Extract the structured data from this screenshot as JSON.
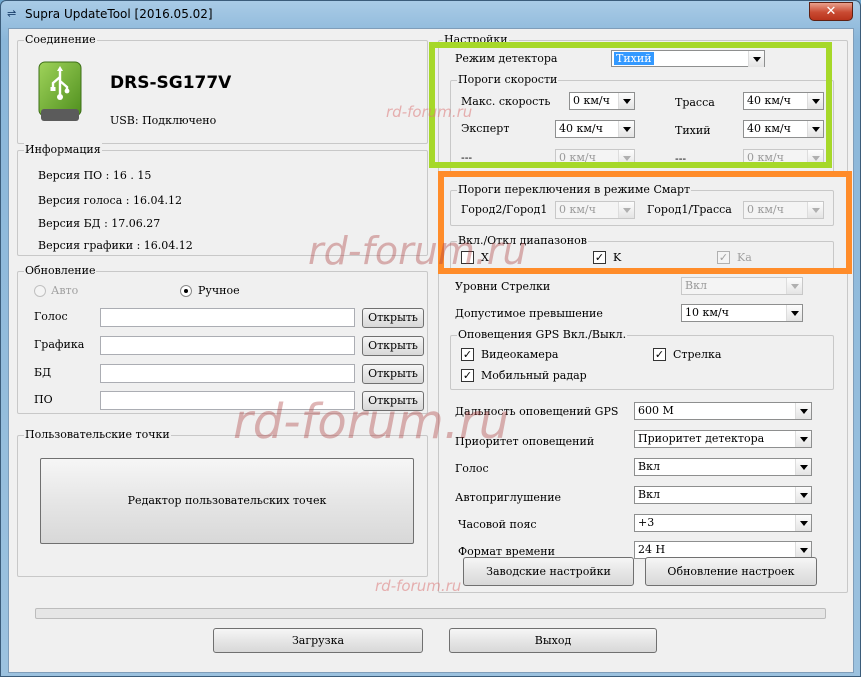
{
  "window": {
    "title": "Supra UpdateTool [2016.05.02]",
    "close_label": "✕"
  },
  "connection": {
    "legend": "Соединение",
    "device": "DRS-SG177V",
    "usb_status": "USB: Подключено"
  },
  "info": {
    "legend": "Информация",
    "fw": "Версия ПО : 16 . 15",
    "voice": "Версия голоса : 16.04.12",
    "db": "Версия БД : 17.06.27",
    "graphics": "Версия графики : 16.04.12"
  },
  "update": {
    "legend": "Обновление",
    "auto": "Авто",
    "manual": "Ручное",
    "rows": [
      {
        "label": "Голос",
        "value": "",
        "button": "Открыть"
      },
      {
        "label": "Графика",
        "value": "",
        "button": "Открыть"
      },
      {
        "label": "БД",
        "value": "",
        "button": "Открыть"
      },
      {
        "label": "ПО",
        "value": "",
        "button": "Открыть"
      }
    ]
  },
  "user_points": {
    "legend": "Пользовательские точки",
    "editor_button": "Редактор пользовательских точек"
  },
  "settings": {
    "legend": "Настройки",
    "detector_mode_label": "Режим детектора",
    "detector_mode_value": "Тихий",
    "speed": {
      "legend": "Пороги скорости",
      "max_label": "Макс. скорость",
      "max_value": "0 км/ч",
      "highway_label": "Трасса",
      "highway_value": "40 км/ч",
      "expert_label": "Эксперт",
      "expert_value": "40 км/ч",
      "quiet_label": "Тихий",
      "quiet_value": "40 км/ч",
      "dash1_label": "---",
      "dash1_value": "0 км/ч",
      "dash2_label": "---",
      "dash2_value": "0 км/ч"
    },
    "smart": {
      "legend": "Пороги переключения в режиме Смарт",
      "city2_label": "Город2/Город1",
      "city2_value": "0 км/ч",
      "city1_label": "Город1/Трасса",
      "city1_value": "0 км/ч"
    },
    "bands": {
      "legend": "Вкл./Откл диапазонов",
      "x": "X",
      "k": "K",
      "ka": "Ka"
    },
    "arrow_levels_label": "Уровни Стрелки",
    "arrow_levels_value": "Вкл",
    "overspeed_label": "Допустимое превышение",
    "overspeed_value": "10 км/ч",
    "gps": {
      "legend": "Оповещения GPS Вкл./Выкл.",
      "camera": "Видеокамера",
      "arrow": "Стрелка",
      "radar": "Мобильный радар"
    },
    "gps_range_label": "Дальность оповещений GPS",
    "gps_range_value": "600 M",
    "priority_label": "Приоритет оповещений",
    "priority_value": "Приоритет детектора",
    "voice_label": "Голос",
    "voice_value": "Вкл",
    "automute_label": "Автоприглушение",
    "automute_value": "Вкл",
    "tz_label": "Часовой пояс",
    "tz_value": "+3",
    "timefmt_label": "Формат времени",
    "timefmt_value": "24 H",
    "factory_button": "Заводские настройки",
    "update_settings_button": "Обновление настроек"
  },
  "progress": {
    "value": 0
  },
  "footer": {
    "download_button": "Загрузка",
    "exit_button": "Выход"
  },
  "watermarks": {
    "small": "rd-forum.ru",
    "large": "rd-forum.ru"
  },
  "colors": {
    "highlight_green": "#a6d829",
    "highlight_orange": "#ff8c2a",
    "selection": "#3399ff"
  }
}
